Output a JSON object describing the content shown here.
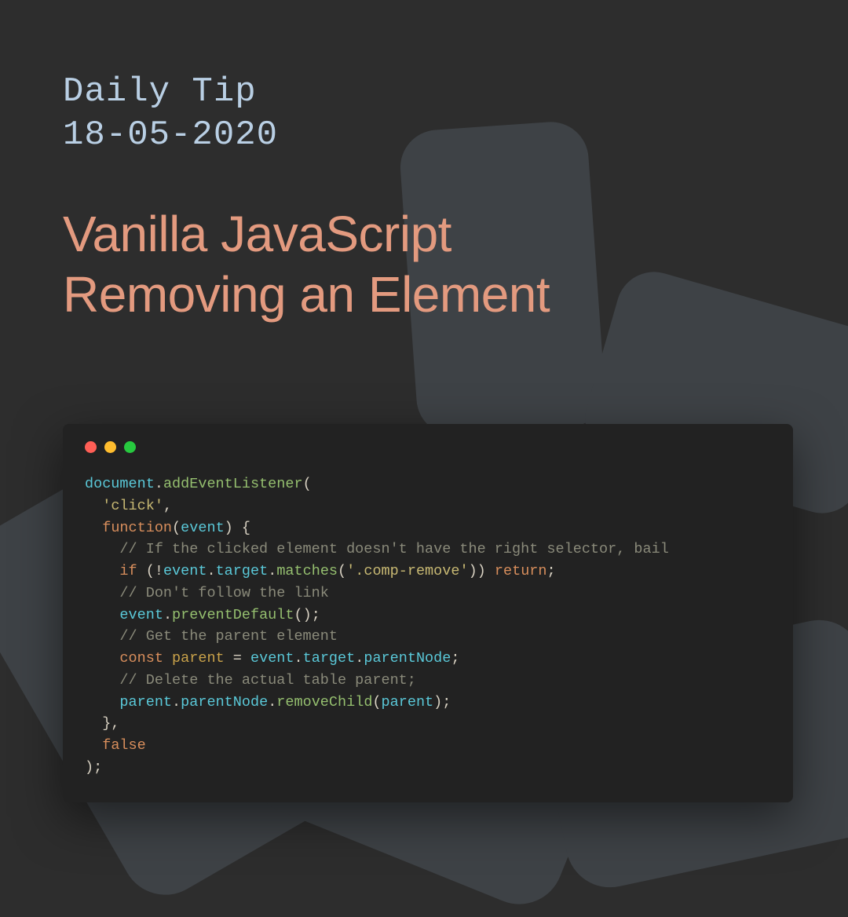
{
  "header": {
    "subtitle_line1": "Daily Tip",
    "subtitle_line2": "18-05-2020",
    "title_line1": "Vanilla JavaScript",
    "title_line2": "Removing an Element"
  },
  "code": {
    "l1_document": "document",
    "l1_dot1": ".",
    "l1_addEventListener": "addEventListener",
    "l1_paren": "(",
    "l2_indent": "  ",
    "l2_click": "'click'",
    "l2_comma": ",",
    "l3_indent": "  ",
    "l3_function": "function",
    "l3_paren_open": "(",
    "l3_event": "event",
    "l3_paren_close_brace": ") {",
    "l4_indent": "    ",
    "l4_comment": "// If the clicked element doesn't have the right selector, bail",
    "l5_indent": "    ",
    "l5_if": "if",
    "l5_open": " (!",
    "l5_event": "event",
    "l5_d1": ".",
    "l5_target": "target",
    "l5_d2": ".",
    "l5_matches": "matches",
    "l5_p1": "(",
    "l5_str": "'.comp-remove'",
    "l5_p2": ")) ",
    "l5_return": "return",
    "l5_semi": ";",
    "l6_indent": "    ",
    "l6_comment": "// Don't follow the link",
    "l7_indent": "    ",
    "l7_event": "event",
    "l7_d1": ".",
    "l7_preventDefault": "preventDefault",
    "l7_paren": "();",
    "l8_indent": "    ",
    "l8_comment": "// Get the parent element",
    "l9_indent": "    ",
    "l9_const": "const",
    "l9_sp": " ",
    "l9_parent": "parent",
    "l9_eq": " = ",
    "l9_event": "event",
    "l9_d1": ".",
    "l9_target": "target",
    "l9_d2": ".",
    "l9_parentNode": "parentNode",
    "l9_semi": ";",
    "l10_indent": "    ",
    "l10_comment": "// Delete the actual table parent;",
    "l11_indent": "    ",
    "l11_parent": "parent",
    "l11_d1": ".",
    "l11_parentNode": "parentNode",
    "l11_d2": ".",
    "l11_removeChild": "removeChild",
    "l11_p1": "(",
    "l11_parentArg": "parent",
    "l11_p2": ");",
    "l12_indent": "  ",
    "l12_close": "},",
    "l13_indent": "  ",
    "l13_false": "false",
    "l14_close": ");"
  }
}
